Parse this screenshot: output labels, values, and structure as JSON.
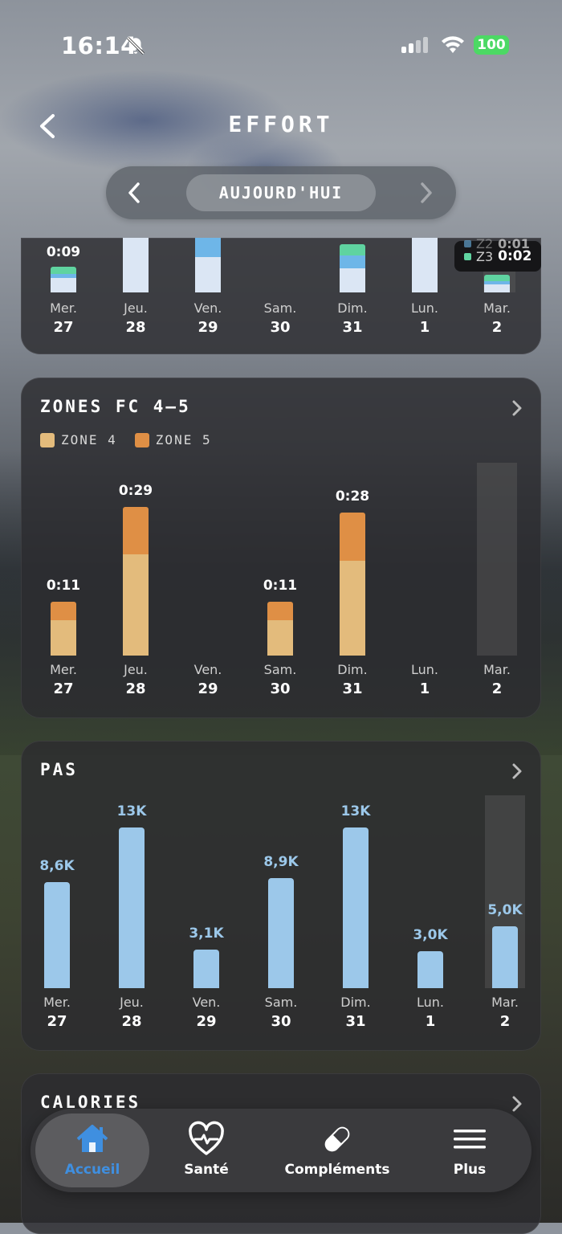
{
  "status": {
    "time": "16:14",
    "battery": "100"
  },
  "header": {
    "title": "EFFORT"
  },
  "period": {
    "label": "AUJOURD'HUI"
  },
  "zone_card": {
    "days": [
      {
        "name": "Mer.",
        "date": "27",
        "label": "0:09"
      },
      {
        "name": "Jeu.",
        "date": "28"
      },
      {
        "name": "Ven.",
        "date": "29"
      },
      {
        "name": "Sam.",
        "date": "30"
      },
      {
        "name": "Dim.",
        "date": "31"
      },
      {
        "name": "Lun.",
        "date": "1"
      },
      {
        "name": "Mar.",
        "date": "2"
      }
    ],
    "tooltip": {
      "zone": "Z3",
      "value": "0:02",
      "prev_zone": "Z2",
      "prev_value": "0:01"
    }
  },
  "hr_card": {
    "title": "ZONES FC 4–5",
    "legend": [
      {
        "label": "ZONE 4",
        "color": "#e3bb7c"
      },
      {
        "label": "ZONE 5",
        "color": "#df8f45"
      }
    ],
    "days": [
      {
        "name": "Mer.",
        "date": "27",
        "label": "0:11",
        "zone4": 6,
        "zone5": 3
      },
      {
        "name": "Jeu.",
        "date": "28",
        "label": "0:29",
        "zone4": 17,
        "zone5": 8
      },
      {
        "name": "Ven.",
        "date": "29",
        "label": "",
        "zone4": 0,
        "zone5": 0
      },
      {
        "name": "Sam.",
        "date": "30",
        "label": "0:11",
        "zone4": 6,
        "zone5": 3
      },
      {
        "name": "Dim.",
        "date": "31",
        "label": "0:28",
        "zone4": 16,
        "zone5": 8
      },
      {
        "name": "Lun.",
        "date": "1",
        "label": "",
        "zone4": 0,
        "zone5": 0
      },
      {
        "name": "Mar.",
        "date": "2",
        "label": "",
        "zone4": 0,
        "zone5": 0
      }
    ]
  },
  "steps_card": {
    "title": "PAS",
    "color": "#9cc8ea",
    "days": [
      {
        "name": "Mer.",
        "date": "27",
        "label": "8,6K",
        "value": 8600
      },
      {
        "name": "Jeu.",
        "date": "28",
        "label": "13K",
        "value": 13000
      },
      {
        "name": "Ven.",
        "date": "29",
        "label": "3,1K",
        "value": 3100
      },
      {
        "name": "Sam.",
        "date": "30",
        "label": "8,9K",
        "value": 8900
      },
      {
        "name": "Dim.",
        "date": "31",
        "label": "13K",
        "value": 13000
      },
      {
        "name": "Lun.",
        "date": "1",
        "label": "3,0K",
        "value": 3000
      },
      {
        "name": "Mar.",
        "date": "2",
        "label": "5,0K",
        "value": 5000
      }
    ]
  },
  "calories_card": {
    "title": "CALORIES"
  },
  "tabs": [
    {
      "label": "Accueil",
      "icon": "home-icon",
      "active": true
    },
    {
      "label": "Santé",
      "icon": "heart-pulse-icon",
      "active": false
    },
    {
      "label": "Compléments",
      "icon": "pill-icon",
      "active": false
    },
    {
      "label": "Plus",
      "icon": "menu-icon",
      "active": false
    }
  ],
  "colors": {
    "accent": "#3f8fe0",
    "zone3": "#5fd3a0",
    "zone_light": "#dbe6f4",
    "zone_blue": "#6eb6e8"
  }
}
